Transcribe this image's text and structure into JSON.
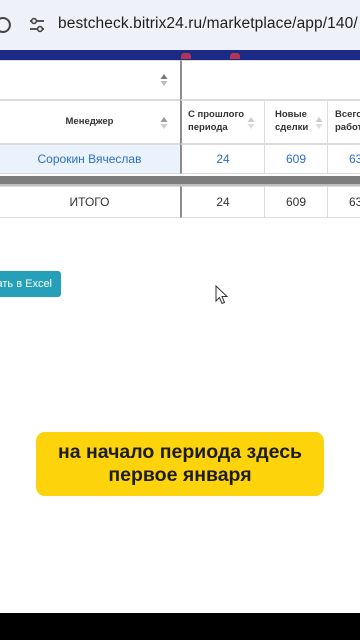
{
  "browser": {
    "url": "bestcheck.bitrix24.ru/marketplace/app/140/"
  },
  "table": {
    "headers": {
      "manager": "Менеджер",
      "from_prev_period": "С прошлого периода",
      "new_deals": "Новые сделки",
      "total": "Всего работ"
    },
    "row": {
      "manager": "Сорокин Вячеслав",
      "from_prev_period": "24",
      "new_deals": "609",
      "total": "63"
    },
    "total_row": {
      "label": "ИТОГО",
      "from_prev_period": "24",
      "new_deals": "609",
      "total": "63"
    }
  },
  "export_button": {
    "label": "ать в Excel"
  },
  "caption": {
    "line1": "на начало периода здесь",
    "line2": "первое января"
  },
  "colors": {
    "accent_blue": "#2b6fc9",
    "button_teal": "#25a0b8",
    "caption_yellow": "#fdd30b",
    "app_strip": "#1b2a85"
  }
}
